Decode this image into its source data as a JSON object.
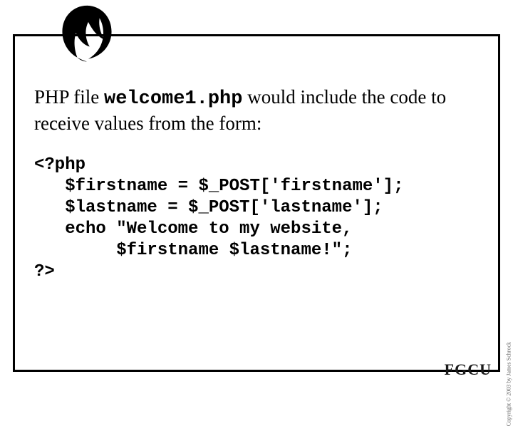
{
  "heading": {
    "prefix": "PHP file ",
    "filename": "welcome1.php",
    "suffix": " would include the code to receive values from the form:"
  },
  "code": {
    "line1": "<?php",
    "line2": "   $firstname = $_POST['firstname'];",
    "line3": "   $lastname = $_POST['lastname'];",
    "line4": "   echo \"Welcome to my website,",
    "line5": "        $firstname $lastname!\";",
    "line6": "?>"
  },
  "footer": {
    "logo_text": "FGCU",
    "copyright": "Copyright © 2003 by James Schrock"
  }
}
